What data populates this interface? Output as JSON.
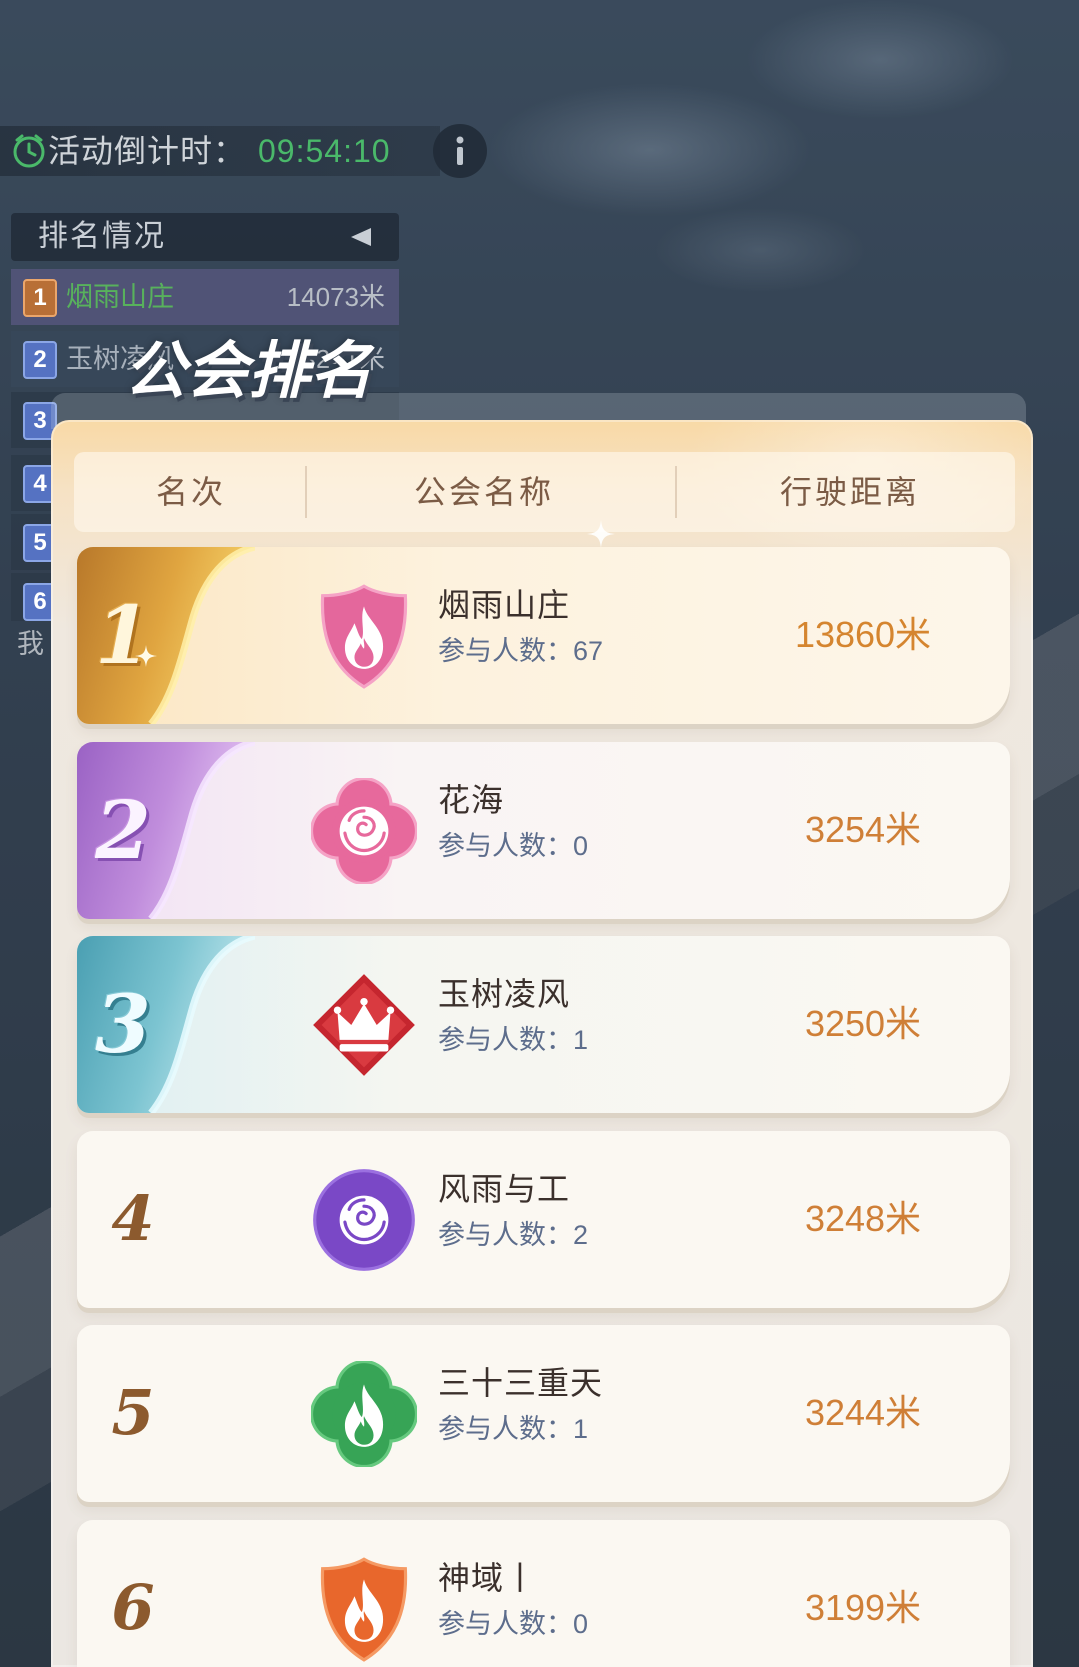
{
  "countdown": {
    "label": "活动倒计时：",
    "time": "09:54:10",
    "icon": "clock-icon",
    "time_color": "#4ab96a"
  },
  "info_button": {
    "icon": "info-icon"
  },
  "side_panel": {
    "title": "排名情况",
    "toggle_icon": "collapse-arrow-icon",
    "rows": [
      {
        "rank": "1",
        "name": "烟雨山庄",
        "distance": "14073米"
      },
      {
        "rank": "2",
        "name": "玉树凌风",
        "distance": "3241米"
      },
      {
        "rank": "3"
      },
      {
        "rank": "4"
      },
      {
        "rank": "5"
      },
      {
        "rank": "6"
      }
    ],
    "self_label": "我"
  },
  "modal": {
    "title": "公会排名",
    "headers": [
      "名次",
      "公会名称",
      "行驶距离"
    ],
    "members_label": "参与人数：",
    "rows": [
      {
        "rank": "1",
        "name": "烟雨山庄",
        "members": "67",
        "distance": "13860米",
        "emblem": "pink-shield-flame-icon",
        "emblem_color": "#e4679c",
        "badge_color": "#e0a540"
      },
      {
        "rank": "2",
        "name": "花海",
        "members": "0",
        "distance": "3254米",
        "emblem": "pink-quatrefoil-rose-icon",
        "emblem_color": "#e7699c",
        "badge_color": "#b07ad4"
      },
      {
        "rank": "3",
        "name": "玉树凌风",
        "members": "1",
        "distance": "3250米",
        "emblem": "red-diamond-crown-icon",
        "emblem_color": "#d72f38",
        "badge_color": "#6cb9c8"
      },
      {
        "rank": "4",
        "name": "风雨与工",
        "members": "2",
        "distance": "3248米",
        "emblem": "purple-circle-rose-icon",
        "emblem_color": "#7a48c6"
      },
      {
        "rank": "5",
        "name": "三十三重天",
        "members": "1",
        "distance": "3244米",
        "emblem": "green-quatrefoil-flame-icon",
        "emblem_color": "#37a456"
      },
      {
        "rank": "6",
        "name": "神域丨",
        "members": "0",
        "distance": "3199米",
        "emblem": "orange-shield-flame-icon",
        "emblem_color": "#e8672c"
      }
    ]
  },
  "colors": {
    "distance": "#cf7f37",
    "members": "#5d6d8c",
    "header_text": "#7b5b45",
    "rank_plain": "#8c5a2e"
  }
}
